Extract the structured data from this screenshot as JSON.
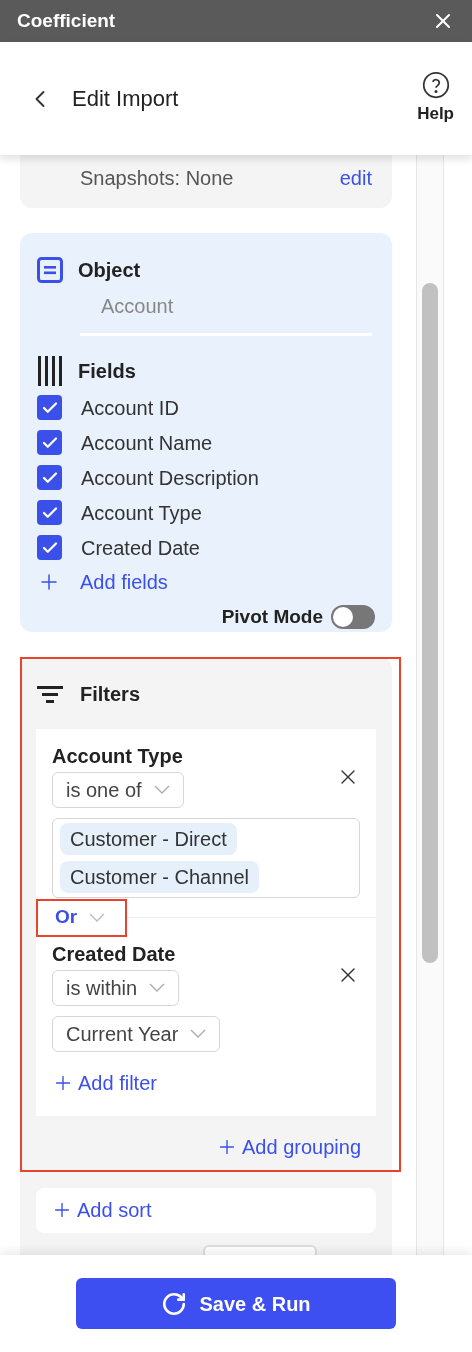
{
  "title_bar": {
    "title": "Coefficient"
  },
  "header": {
    "title": "Edit Import",
    "help": "Help"
  },
  "schedule_card": {
    "snapshots": "Snapshots: None",
    "edit": "edit"
  },
  "object": {
    "label": "Object",
    "value": "Account"
  },
  "fields": {
    "label": "Fields",
    "add": "Add fields",
    "items": [
      {
        "name": "Account ID",
        "checked": true
      },
      {
        "name": "Account Name",
        "checked": true
      },
      {
        "name": "Account Description",
        "checked": true
      },
      {
        "name": "Account Type",
        "checked": true
      },
      {
        "name": "Created Date",
        "checked": true
      }
    ]
  },
  "pivot_mode": {
    "label": "Pivot Mode",
    "on": false
  },
  "filters": {
    "label": "Filters",
    "connector": "Or",
    "add_filter": "Add filter",
    "add_grouping": "Add grouping",
    "items": [
      {
        "kind": "multi",
        "field": "Account Type",
        "operator": "is one of",
        "values": [
          "Customer - Direct",
          "Customer - Channel"
        ]
      },
      {
        "kind": "select",
        "field": "Created Date",
        "operator": "is within",
        "value": "Current Year"
      }
    ]
  },
  "add_sort": "Add sort",
  "footer": {
    "button": "Save & Run"
  }
}
